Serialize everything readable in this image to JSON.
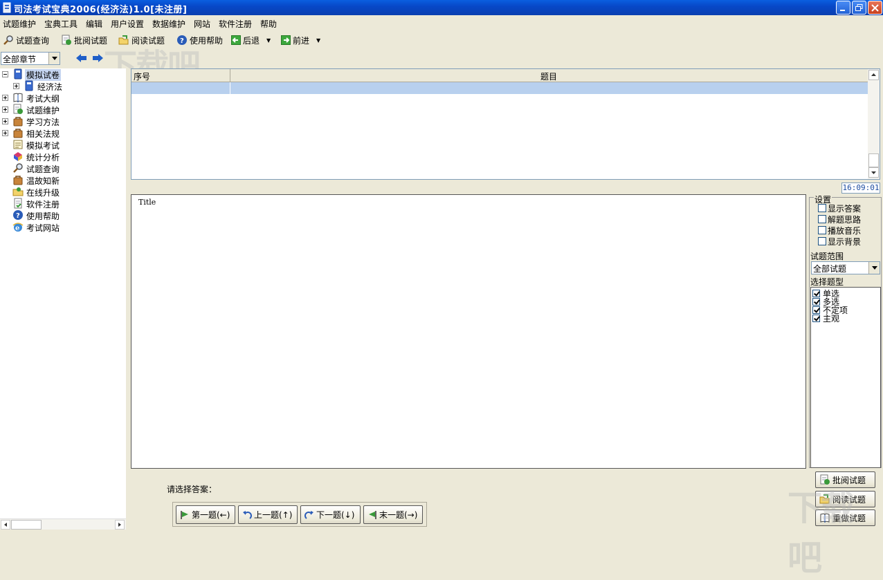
{
  "window": {
    "title": "司法考试宝典2006(经济法)1.0[未注册]"
  },
  "menu": [
    "试题维护",
    "宝典工具",
    "编辑",
    "用户设置",
    "数据维护",
    "网站",
    "软件注册",
    "帮助"
  ],
  "toolbar": {
    "query": "试题查询",
    "review": "批阅试题",
    "read": "阅读试题",
    "help": "使用帮助",
    "back": "后退",
    "forward": "前进"
  },
  "chapter_select": {
    "value": "全部章节"
  },
  "tree": [
    {
      "label": "模拟试卷",
      "icon": "mock-paper-icon"
    },
    {
      "label": "经济法",
      "icon": "law-book-icon"
    },
    {
      "label": "考试大纲",
      "icon": "outline-book-icon"
    },
    {
      "label": "试题维护",
      "icon": "maintenance-icon"
    },
    {
      "label": "学习方法",
      "icon": "study-bag-icon"
    },
    {
      "label": "相关法规",
      "icon": "regulation-bag-icon"
    },
    {
      "label": "模拟考试",
      "icon": "exam-paper-icon"
    },
    {
      "label": "统计分析",
      "icon": "statistics-icon"
    },
    {
      "label": "试题查询",
      "icon": "magnifier-icon"
    },
    {
      "label": "温故知新",
      "icon": "review-bag-icon"
    },
    {
      "label": "在线升级",
      "icon": "upgrade-folder-icon"
    },
    {
      "label": "软件注册",
      "icon": "register-icon"
    },
    {
      "label": "使用帮助",
      "icon": "help-icon"
    },
    {
      "label": "考试网站",
      "icon": "ie-globe-icon"
    }
  ],
  "grid": {
    "columns": [
      "序号",
      "题目"
    ]
  },
  "clock": "16:09:01",
  "content": {
    "title": "Title"
  },
  "settings": {
    "legend": "设置",
    "options": [
      "显示答案",
      "解题思路",
      "播放音乐",
      "显示背景"
    ],
    "range_label": "试题范围",
    "range_value": "全部试题",
    "type_label": "选择题型",
    "types": [
      "单选",
      "多选",
      "不定项",
      "主观"
    ]
  },
  "bottom": {
    "prompt": "请选择答案：",
    "first": "第一题(←)",
    "prev": "上一题(↑)",
    "next": "下一题(↓)",
    "last": "末一题(→)"
  },
  "right_buttons": {
    "review": "批阅试题",
    "read": "阅读试题",
    "redo": "重做试题"
  },
  "watermark": "下载吧"
}
